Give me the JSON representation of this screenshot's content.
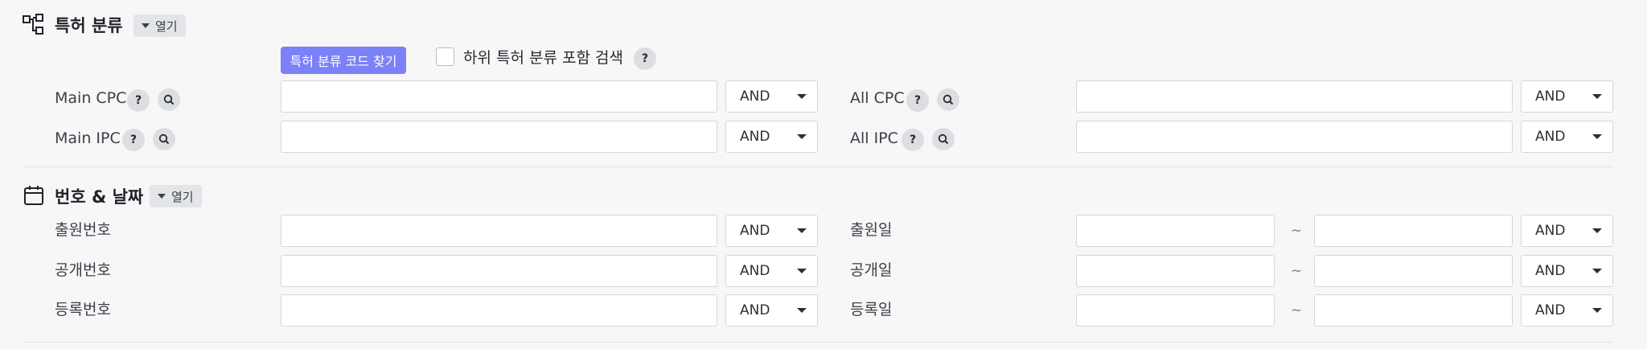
{
  "sections": {
    "classification": {
      "title": "특허 분류",
      "toggle_label": "열기",
      "find_code_button": "특허 분류 코드 찾기",
      "include_sub_label": "하위 특허 분류 포함 검색",
      "rows": {
        "main_cpc": {
          "label": "Main CPC",
          "value": "",
          "operator": "AND"
        },
        "all_cpc": {
          "label": "All CPC",
          "value": "",
          "operator": "AND"
        },
        "main_ipc": {
          "label": "Main IPC",
          "value": "",
          "operator": "AND"
        },
        "all_ipc": {
          "label": "All IPC",
          "value": "",
          "operator": "AND"
        }
      }
    },
    "number_date": {
      "title": "번호 & 날짜",
      "toggle_label": "열기",
      "rows": {
        "application_no": {
          "label": "출원번호",
          "value": "",
          "operator": "AND"
        },
        "publication_no": {
          "label": "공개번호",
          "value": "",
          "operator": "AND"
        },
        "registration_no": {
          "label": "등록번호",
          "value": "",
          "operator": "AND"
        },
        "application_date": {
          "label": "출원일",
          "from": "",
          "to": "",
          "operator": "AND"
        },
        "publication_date": {
          "label": "공개일",
          "from": "",
          "to": "",
          "operator": "AND"
        },
        "registration_date": {
          "label": "등록일",
          "from": "",
          "to": "",
          "operator": "AND"
        }
      },
      "range_separator": "~"
    }
  },
  "symbols": {
    "help": "?"
  },
  "icons": {
    "classification": "hierarchy-icon",
    "number_date": "calendar-icon",
    "help": "help-icon",
    "search": "search-icon",
    "dropdown": "chevron-down-icon"
  }
}
